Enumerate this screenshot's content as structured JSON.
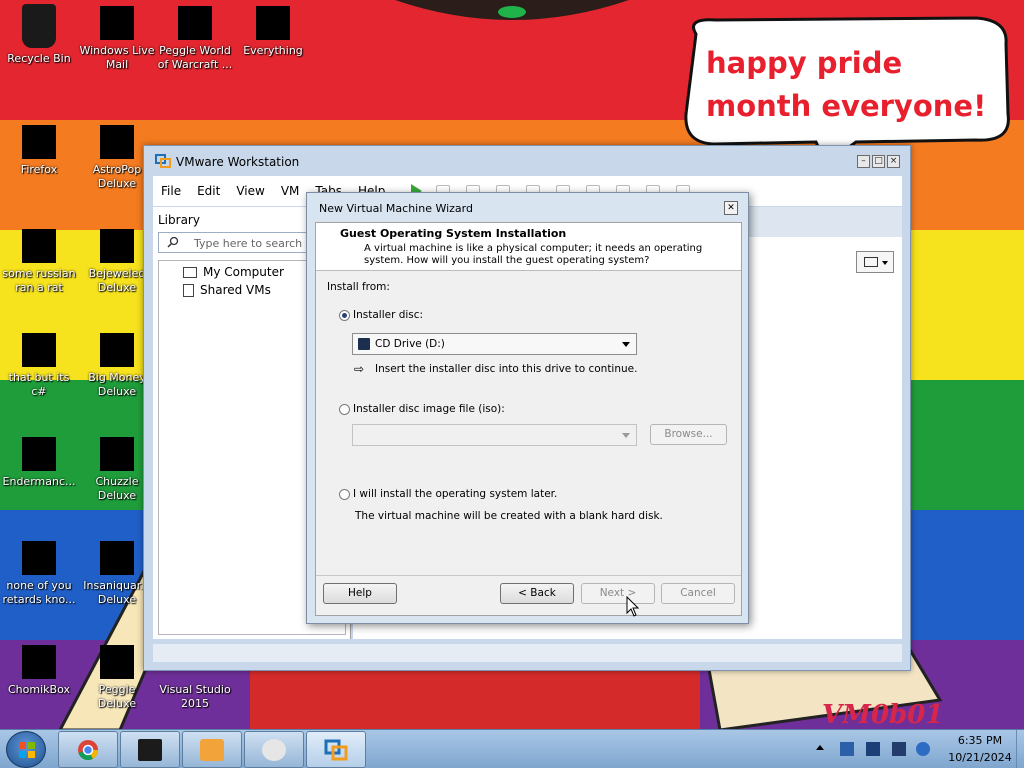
{
  "desktop": {
    "icons": [
      {
        "label": "Recycle Bin",
        "icon": "recycle-bin-icon"
      },
      {
        "label": "Windows Live Mail",
        "icon": "mail-icon"
      },
      {
        "label": "Peggle World of Warcraft ...",
        "icon": "game-icon"
      },
      {
        "label": "Everything",
        "icon": "search-app-icon"
      },
      {
        "label": "Firefox",
        "icon": "firefox-icon"
      },
      {
        "label": "AstroPop Deluxe",
        "icon": "game-icon"
      },
      {
        "label": "some russian ran a rat",
        "icon": "app-icon"
      },
      {
        "label": "Bejeweled Deluxe",
        "icon": "game-icon"
      },
      {
        "label": "that but its c#",
        "icon": "app-icon"
      },
      {
        "label": "Big Money Deluxe",
        "icon": "game-icon"
      },
      {
        "label": "Endermanc...",
        "icon": "app-icon"
      },
      {
        "label": "Chuzzle Deluxe",
        "icon": "game-icon"
      },
      {
        "label": "none of you retards kno...",
        "icon": "app-icon"
      },
      {
        "label": "Insaniquar... Deluxe",
        "icon": "game-icon"
      },
      {
        "label": "ChomikBox",
        "icon": "app-icon"
      },
      {
        "label": "Peggle Deluxe",
        "icon": "game-icon"
      },
      {
        "label": "Visual Studio 2015",
        "icon": "visual-studio-icon"
      }
    ],
    "speech_bubble": "happy pride month everyone!",
    "watermark": "VM0b01",
    "wallpaper_colors": [
      "#e3262f",
      "#f47b20",
      "#f6e21d",
      "#1f9d3a",
      "#1f5fc7",
      "#6f2f9a"
    ]
  },
  "vmware": {
    "title": "VMware Workstation",
    "menu": [
      "File",
      "Edit",
      "View",
      "VM",
      "Tabs",
      "Help"
    ],
    "library": {
      "heading": "Library",
      "search_placeholder": "Type here to search",
      "nodes": [
        "My Computer",
        "Shared VMs"
      ]
    }
  },
  "wizard": {
    "title": "New Virtual Machine Wizard",
    "header_title": "Guest Operating System Installation",
    "header_desc": "A virtual machine is like a physical computer; it needs an operating system. How will you install the guest operating system?",
    "install_from": "Install from:",
    "opt_disc": "Installer disc:",
    "drive_value": "CD Drive (D:)",
    "disc_hint": "Insert the installer disc into this drive to continue.",
    "opt_iso": "Installer disc image file (iso):",
    "iso_value": "",
    "browse": "Browse...",
    "opt_later": "I will install the operating system later.",
    "later_desc": "The virtual machine will be created with a blank hard disk.",
    "selected_option": "installer-disc",
    "buttons": {
      "help": "Help",
      "back": "< Back",
      "next": "Next >",
      "cancel": "Cancel"
    }
  },
  "taskbar": {
    "pinned": [
      "chrome-icon",
      "terminal-icon",
      "media-player-icon",
      "disc-image-icon",
      "vmware-icon"
    ],
    "time": "6:35 PM",
    "date": "10/21/2024"
  }
}
